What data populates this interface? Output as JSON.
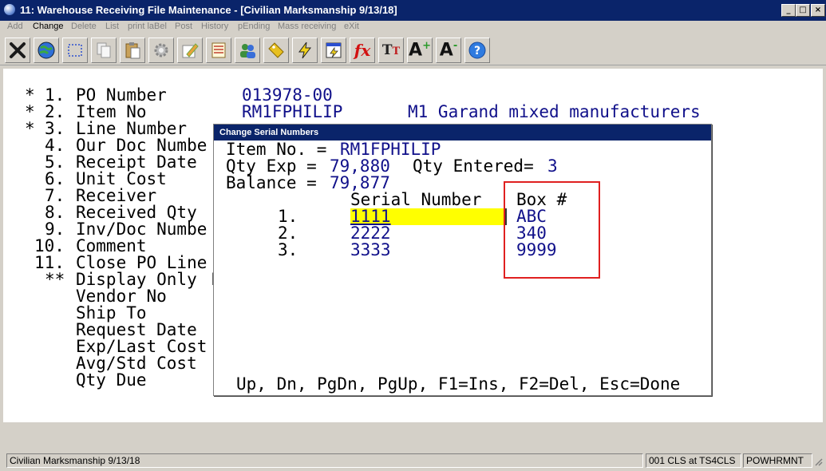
{
  "window": {
    "title": "11: Warehouse Receiving File Maintenance - [Civilian Marksmanship 9/13/18]"
  },
  "menu": [
    "Add",
    "Change",
    "Delete",
    "List",
    "print laBel",
    "Post",
    "History",
    "pEnding",
    "Mass receiving",
    "eXit"
  ],
  "toolbar_icons": [
    "exit-x-icon",
    "globe-icon",
    "select-rect-icon",
    "copy-icon",
    "paste-icon",
    "settings-gear-icon",
    "edit-pencil-icon",
    "notepad-icon",
    "users-icon",
    "tag-icon",
    "lightning-icon",
    "calculator-icon",
    "function-fx-icon",
    "text-tt-icon",
    "increase-font-icon",
    "decrease-font-icon",
    "help-icon"
  ],
  "form": {
    "rows": [
      {
        "mark": "*",
        "num": "1.",
        "label": "PO Number",
        "value": "013978-00",
        "extra": ""
      },
      {
        "mark": "*",
        "num": "2.",
        "label": "Item No",
        "value": "RM1FPHILIP",
        "extra": "M1 Garand mixed manufacturers"
      },
      {
        "mark": "*",
        "num": "3.",
        "label": "Line Number",
        "value": "",
        "extra": ""
      },
      {
        "mark": "",
        "num": "4.",
        "label": "Our Doc Numbe",
        "value": "",
        "extra": ""
      },
      {
        "mark": "",
        "num": "5.",
        "label": "Receipt Date",
        "value": "",
        "extra": ""
      },
      {
        "mark": "",
        "num": "6.",
        "label": "Unit Cost",
        "value": "",
        "extra": ""
      },
      {
        "mark": "",
        "num": "7.",
        "label": "Receiver",
        "value": "",
        "extra": ""
      },
      {
        "mark": "",
        "num": "8.",
        "label": "Received Qty",
        "value": "",
        "extra": ""
      },
      {
        "mark": "",
        "num": "9.",
        "label": "Inv/Doc Numbe",
        "value": "",
        "extra": ""
      },
      {
        "mark": "",
        "num": "10.",
        "label": "Comment",
        "value": "",
        "extra": ""
      },
      {
        "mark": "",
        "num": "11.",
        "label": "Close PO Line",
        "value": "",
        "extra": ""
      }
    ],
    "display_only_mark": "**",
    "display_only_label": "Display Only",
    "display_only_cut": "F",
    "display_fields": [
      "Vendor No",
      "Ship To",
      "Request Date",
      "Exp/Last Cost",
      "Avg/Std Cost",
      "Qty Due"
    ]
  },
  "dialog": {
    "title": "Change Serial Numbers",
    "item_label": "Item No. =",
    "item_value": "RM1FPHILIP",
    "qty_exp_label": "Qty Exp =",
    "qty_exp_value": "79,880",
    "qty_entered_label": "Qty Entered=",
    "qty_entered_value": "3",
    "balance_label": "Balance =",
    "balance_value": "79,877",
    "col_serial": "Serial Number",
    "col_box": "Box #",
    "rows": [
      {
        "num": "1.",
        "serial": "1111",
        "box": "ABC"
      },
      {
        "num": "2.",
        "serial": "2222",
        "box": "340"
      },
      {
        "num": "3.",
        "serial": "3333",
        "box": "9999"
      }
    ],
    "help": "Up, Dn, PgDn, PgUp, F1=Ins, F2=Del, Esc=Done",
    "highlight_color": "#ffff00",
    "annotation_color": "#e02020"
  },
  "status": {
    "company": "Civilian Marksmanship 9/13/18",
    "session": "001 CLS at TS4CLS",
    "program": "POWHRMNT"
  }
}
